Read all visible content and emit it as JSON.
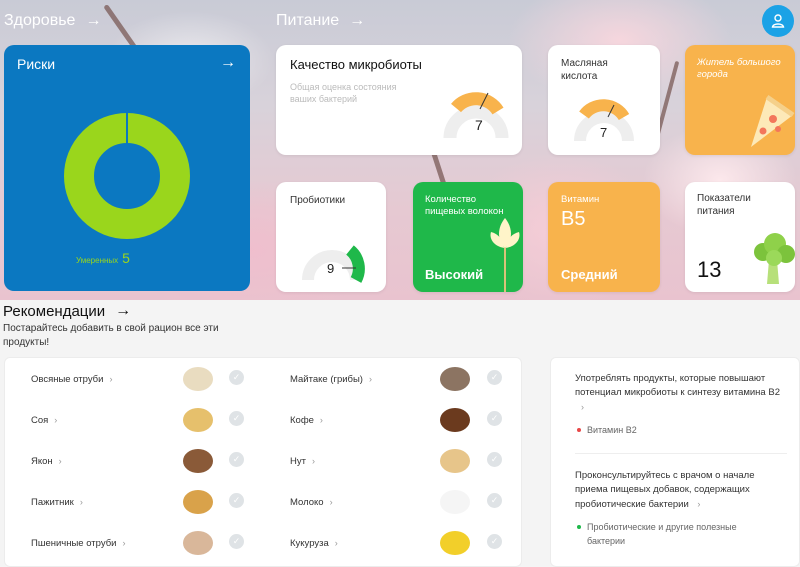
{
  "header": {
    "health_title": "Здоровье",
    "nutrition_title": "Питание",
    "arrow": "→"
  },
  "risks_card": {
    "title": "Риски",
    "arrow": "→",
    "level_label": "Умеренных",
    "level_count": "5",
    "donut_color": "#9ad61c",
    "bg_color": "#0b78c1"
  },
  "cards": {
    "microbiota_quality": {
      "title": "Качество микробиоты",
      "subtitle": "Общая оценка состояния ваших бактерий",
      "value": "7"
    },
    "butyric_acid": {
      "title": "Масляная кислота",
      "value": "7"
    },
    "city_dweller": {
      "title": "Житель большого города",
      "icon": "pizza-icon",
      "bg_color": "#f8b34c"
    },
    "probiotics": {
      "title": "Пробиотики",
      "value": "9"
    },
    "fiber": {
      "title": "Количество пищевых волокон",
      "value": "Высокий",
      "icon": "wheat-icon",
      "bg_color": "#1fb84a"
    },
    "vitamin_b5": {
      "title": "Витамин",
      "big": "B5",
      "value": "Средний",
      "bg_color": "#f8b34c"
    },
    "nutrition_indicators": {
      "title": "Показатели питания",
      "value": "13",
      "icon": "broccoli-icon"
    }
  },
  "recommendations": {
    "title": "Рекомендации",
    "arrow": "→",
    "subtitle": "Постарайтесь добавить в свой рацион все эти продукты!",
    "products_left": [
      {
        "name": "Овсяные отруби",
        "icon": "oat-bran-icon"
      },
      {
        "name": "Соя",
        "icon": "soy-icon"
      },
      {
        "name": "Якон",
        "icon": "yacon-icon"
      },
      {
        "name": "Пажитник",
        "icon": "fenugreek-icon"
      },
      {
        "name": "Пшеничные отруби",
        "icon": "wheat-bran-icon"
      }
    ],
    "products_right": [
      {
        "name": "Майтаке (грибы)",
        "icon": "mushroom-icon"
      },
      {
        "name": "Кофе",
        "icon": "coffee-icon"
      },
      {
        "name": "Нут",
        "icon": "chickpea-icon"
      },
      {
        "name": "Молоко",
        "icon": "milk-icon"
      },
      {
        "name": "Кукуруза",
        "icon": "corn-icon"
      }
    ],
    "chevron": "›",
    "advice": [
      {
        "text": "Употреблять продукты, которые повышают потенциал микробиоты к синтезу витамина B2",
        "tag": "Витамин B2",
        "tag_color": "#e84848"
      },
      {
        "text": "Проконсультируйтесь с врачом о начале приема пищевых добавок, содержащих пробиотические бактерии",
        "tag": "Пробиотические и другие полезные бактерии",
        "tag_color": "#1fb84a"
      }
    ]
  }
}
